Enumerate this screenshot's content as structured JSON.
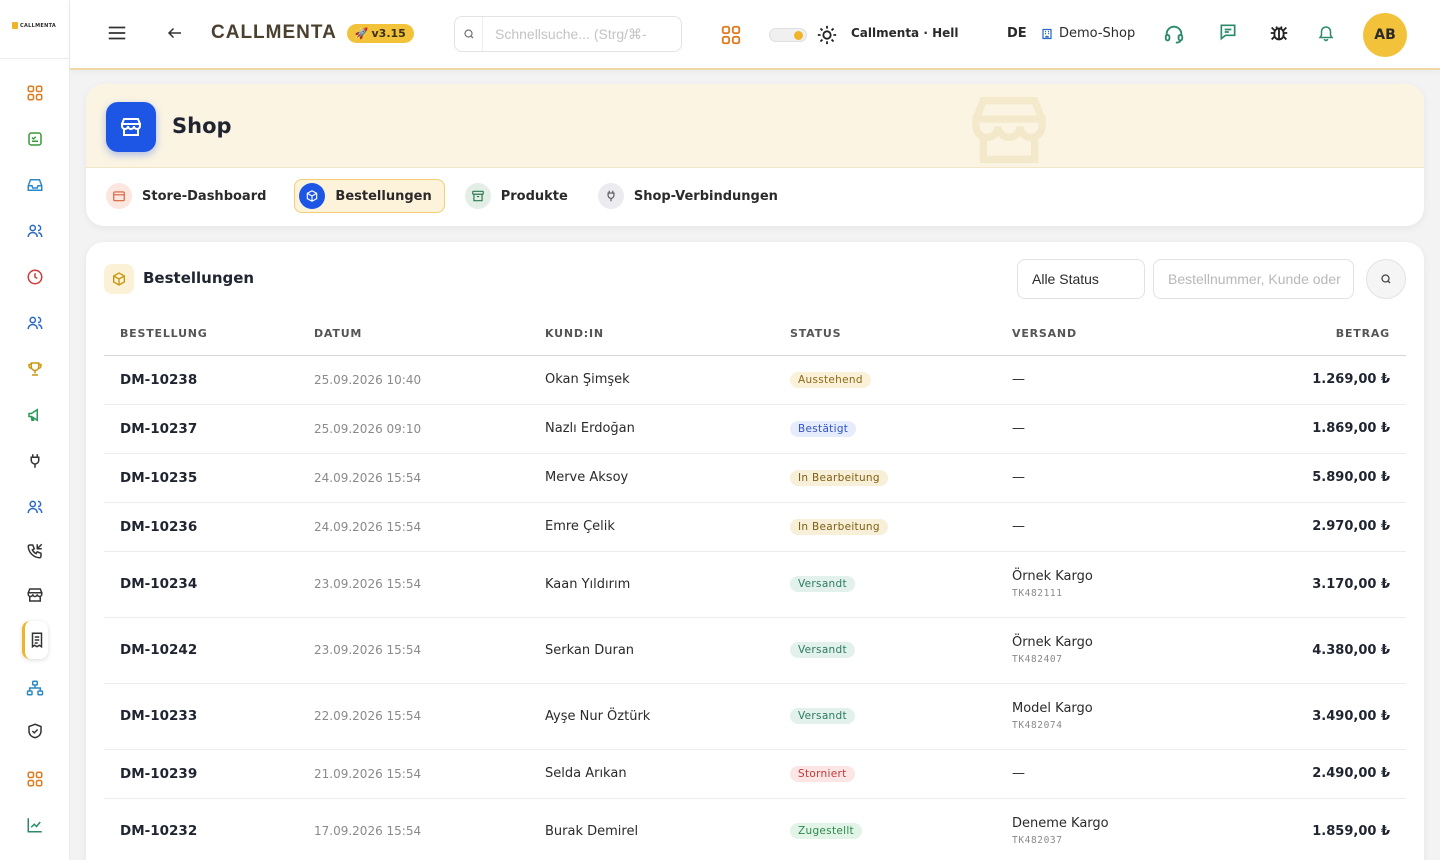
{
  "app": {
    "logo_text": "CALLMENTA",
    "brand_name": "CALLMENTA",
    "version": "v3.15"
  },
  "colors": {
    "accent": "#f3c23b",
    "primary": "#1d56e5",
    "background": "#f3f3f4"
  },
  "sidebar": {
    "items": [
      {
        "name": "dashboard",
        "icon": "grid-icon",
        "color": "#e07a1f"
      },
      {
        "name": "tasks",
        "icon": "checklist-icon",
        "color": "#3a9a3a"
      },
      {
        "name": "inbox",
        "icon": "inbox-icon",
        "color": "#2a8ac7"
      },
      {
        "name": "contacts",
        "icon": "users-icon",
        "color": "#2a6ac7"
      },
      {
        "name": "time",
        "icon": "clock-icon",
        "color": "#d23a3a"
      },
      {
        "name": "team",
        "icon": "users-icon",
        "color": "#2a6ac7"
      },
      {
        "name": "achievements",
        "icon": "trophy-icon",
        "color": "#c8960f"
      },
      {
        "name": "campaigns",
        "icon": "megaphone-icon",
        "color": "#2a9a5a"
      },
      {
        "name": "integrations",
        "icon": "plug-icon",
        "color": "#333333"
      },
      {
        "name": "users",
        "icon": "users-icon",
        "color": "#2a6ac7"
      },
      {
        "name": "calls",
        "icon": "phone-incoming-icon",
        "color": "#333333"
      },
      {
        "name": "shop",
        "icon": "store-icon",
        "color": "#333333"
      },
      {
        "name": "orders",
        "icon": "receipt-icon",
        "color": "#333333"
      },
      {
        "name": "hierarchy",
        "icon": "sitemap-icon",
        "color": "#2a8ac7"
      },
      {
        "name": "security",
        "icon": "shield-check-icon",
        "color": "#333333"
      },
      {
        "name": "apps",
        "icon": "grid-icon",
        "color": "#e07a1f"
      },
      {
        "name": "analytics",
        "icon": "chart-line-icon",
        "color": "#2a8a6a"
      }
    ]
  },
  "topbar": {
    "search_placeholder": "Schnellsuche... (Strg/⌘-",
    "theme_label": "Callmenta · Hell",
    "language": "DE",
    "shop_selector": "Demo-Shop",
    "avatar_initials": "AB"
  },
  "shop": {
    "title": "Shop",
    "tabs": [
      {
        "label": "Store-Dashboard",
        "icon": "calendar-card-icon",
        "active": false
      },
      {
        "label": "Bestellungen",
        "icon": "package-icon",
        "active": true
      },
      {
        "label": "Produkte",
        "icon": "archive-icon",
        "active": false
      },
      {
        "label": "Shop-Verbindungen",
        "icon": "plug-icon",
        "active": false
      }
    ]
  },
  "orders": {
    "title": "Bestellungen",
    "status_filter": "Alle Status",
    "search_placeholder": "Bestellnummer, Kunde oder",
    "columns": {
      "order": "BESTELLUNG",
      "date": "DATUM",
      "customer": "KUND:IN",
      "status": "STATUS",
      "shipping": "VERSAND",
      "amount": "BETRAG"
    },
    "rows": [
      {
        "id": "DM-10238",
        "date": "25.09.2026 10:40",
        "customer": "Okan Şimşek",
        "status": "Ausstehend",
        "status_key": "ausstehend",
        "carrier": "—",
        "tracking": "",
        "amount": "1.269,00 ₺"
      },
      {
        "id": "DM-10237",
        "date": "25.09.2026 09:10",
        "customer": "Nazlı Erdoğan",
        "status": "Bestätigt",
        "status_key": "bestaetigt",
        "carrier": "—",
        "tracking": "",
        "amount": "1.869,00 ₺"
      },
      {
        "id": "DM-10235",
        "date": "24.09.2026 15:54",
        "customer": "Merve Aksoy",
        "status": "In Bearbeitung",
        "status_key": "bearbeitung",
        "carrier": "—",
        "tracking": "",
        "amount": "5.890,00 ₺"
      },
      {
        "id": "DM-10236",
        "date": "24.09.2026 15:54",
        "customer": "Emre Çelik",
        "status": "In Bearbeitung",
        "status_key": "bearbeitung",
        "carrier": "—",
        "tracking": "",
        "amount": "2.970,00 ₺"
      },
      {
        "id": "DM-10234",
        "date": "23.09.2026 15:54",
        "customer": "Kaan Yıldırım",
        "status": "Versandt",
        "status_key": "versandt",
        "carrier": "Örnek Kargo",
        "tracking": "TK482111",
        "amount": "3.170,00 ₺"
      },
      {
        "id": "DM-10242",
        "date": "23.09.2026 15:54",
        "customer": "Serkan Duran",
        "status": "Versandt",
        "status_key": "versandt",
        "carrier": "Örnek Kargo",
        "tracking": "TK482407",
        "amount": "4.380,00 ₺"
      },
      {
        "id": "DM-10233",
        "date": "22.09.2026 15:54",
        "customer": "Ayşe Nur Öztürk",
        "status": "Versandt",
        "status_key": "versandt",
        "carrier": "Model Kargo",
        "tracking": "TK482074",
        "amount": "3.490,00 ₺"
      },
      {
        "id": "DM-10239",
        "date": "21.09.2026 15:54",
        "customer": "Selda Arıkan",
        "status": "Storniert",
        "status_key": "storniert",
        "carrier": "—",
        "tracking": "",
        "amount": "2.490,00 ₺"
      },
      {
        "id": "DM-10232",
        "date": "17.09.2026 15:54",
        "customer": "Burak Demirel",
        "status": "Zugestellt",
        "status_key": "zugestellt",
        "carrier": "Deneme Kargo",
        "tracking": "TK482037",
        "amount": "1.859,00 ₺"
      }
    ]
  }
}
